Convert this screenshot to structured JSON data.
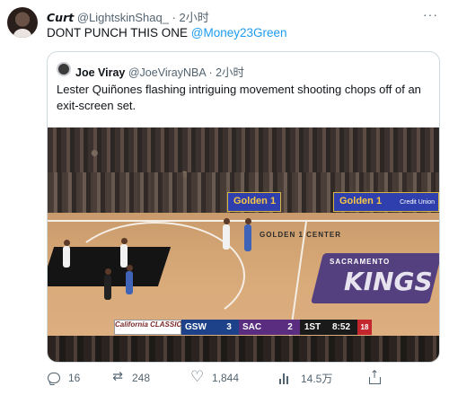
{
  "tweet": {
    "display_name": "Curt",
    "handle": "@LightskinShaq_",
    "separator": "·",
    "time": "2小时",
    "more_label": "···",
    "text": "DONT PUNCH THIS ONE",
    "mention": "@Money23Green"
  },
  "quoted_tweet": {
    "display_name": "Joe Viray",
    "handle": "@JoeVirayNBA",
    "separator": "·",
    "time": "2小时",
    "text": "Lester Quiñones flashing intriguing movement shooting chops off of an exit-screen set.",
    "media": {
      "ad_board_left": "Golden 1",
      "ad_board_right": "Golden 1",
      "ad_board_right_sub": "Credit Union",
      "court_text": "GOLDEN 1 CENTER",
      "court_logo_top": "SACRAMENTO",
      "court_logo_main": "KINGS",
      "scoreboard": {
        "event": "California CLASSIC",
        "team1": "GSW",
        "score1": "3",
        "team2": "SAC",
        "score2": "2",
        "period": "1ST",
        "clock": "8:52",
        "shot_clock": "18"
      }
    }
  },
  "actions": {
    "replies": "16",
    "retweets": "248",
    "likes": "1,844",
    "views": "14.5万"
  },
  "colors": {
    "link": "#1d9bf0",
    "secondary_text": "#536471",
    "border": "#cfd9de"
  }
}
